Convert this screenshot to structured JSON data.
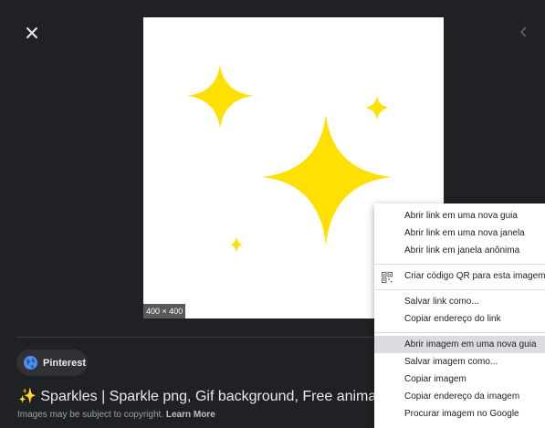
{
  "viewer": {
    "image_dims": "400 × 400",
    "source_name": "Pinterest",
    "title": "✨ Sparkles | Sparkle png, Gif background, Free animation",
    "copyright_text": "Images may be subject to copyright.",
    "learn_more": "Learn More"
  },
  "icons": {
    "close": "close-icon",
    "previous": "chevron-left-icon",
    "source": "globe-icon",
    "qr": "qr-code-icon"
  },
  "colors": {
    "background": "#202124",
    "sparkle": "#FFE000",
    "menu_highlight": "#dadce0"
  },
  "context_menu": {
    "items": [
      "Abrir link em uma nova guia",
      "Abrir link em uma nova janela",
      "Abrir link em janela anônima",
      "Criar código QR para esta imagem",
      "Salvar link como...",
      "Copiar endereço do link",
      "Abrir imagem em uma nova guia",
      "Salvar imagem como...",
      "Copiar imagem",
      "Copiar endereço da imagem",
      "Procurar imagem no Google"
    ],
    "highlighted": "Abrir imagem em uma nova guia"
  }
}
